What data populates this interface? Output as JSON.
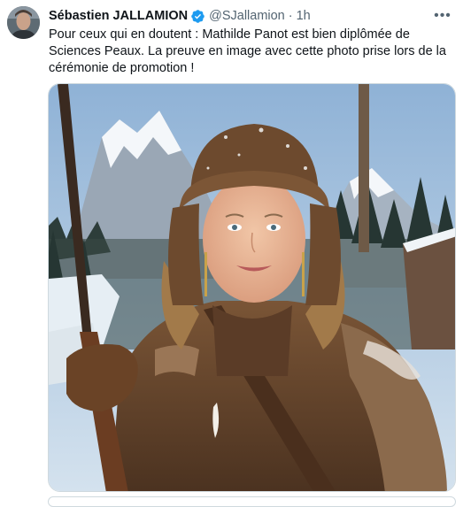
{
  "tweet": {
    "author_name": "Sébastien JALLAMION",
    "handle": "@SJallamion",
    "separator": "·",
    "time": "1h",
    "text": "Pour ceux qui en doutent : Mathilde Panot est bien diplômée de Sciences Peaux. La preuve en image avec cette photo prise lors de la cérémonie de promotion !",
    "more_label": "•••",
    "icons": {
      "verified": "verified-badge-icon",
      "more": "more-options-icon"
    }
  },
  "colors": {
    "verified": "#1d9bf0",
    "secondary_text": "#536471",
    "border": "#cfd9de"
  }
}
